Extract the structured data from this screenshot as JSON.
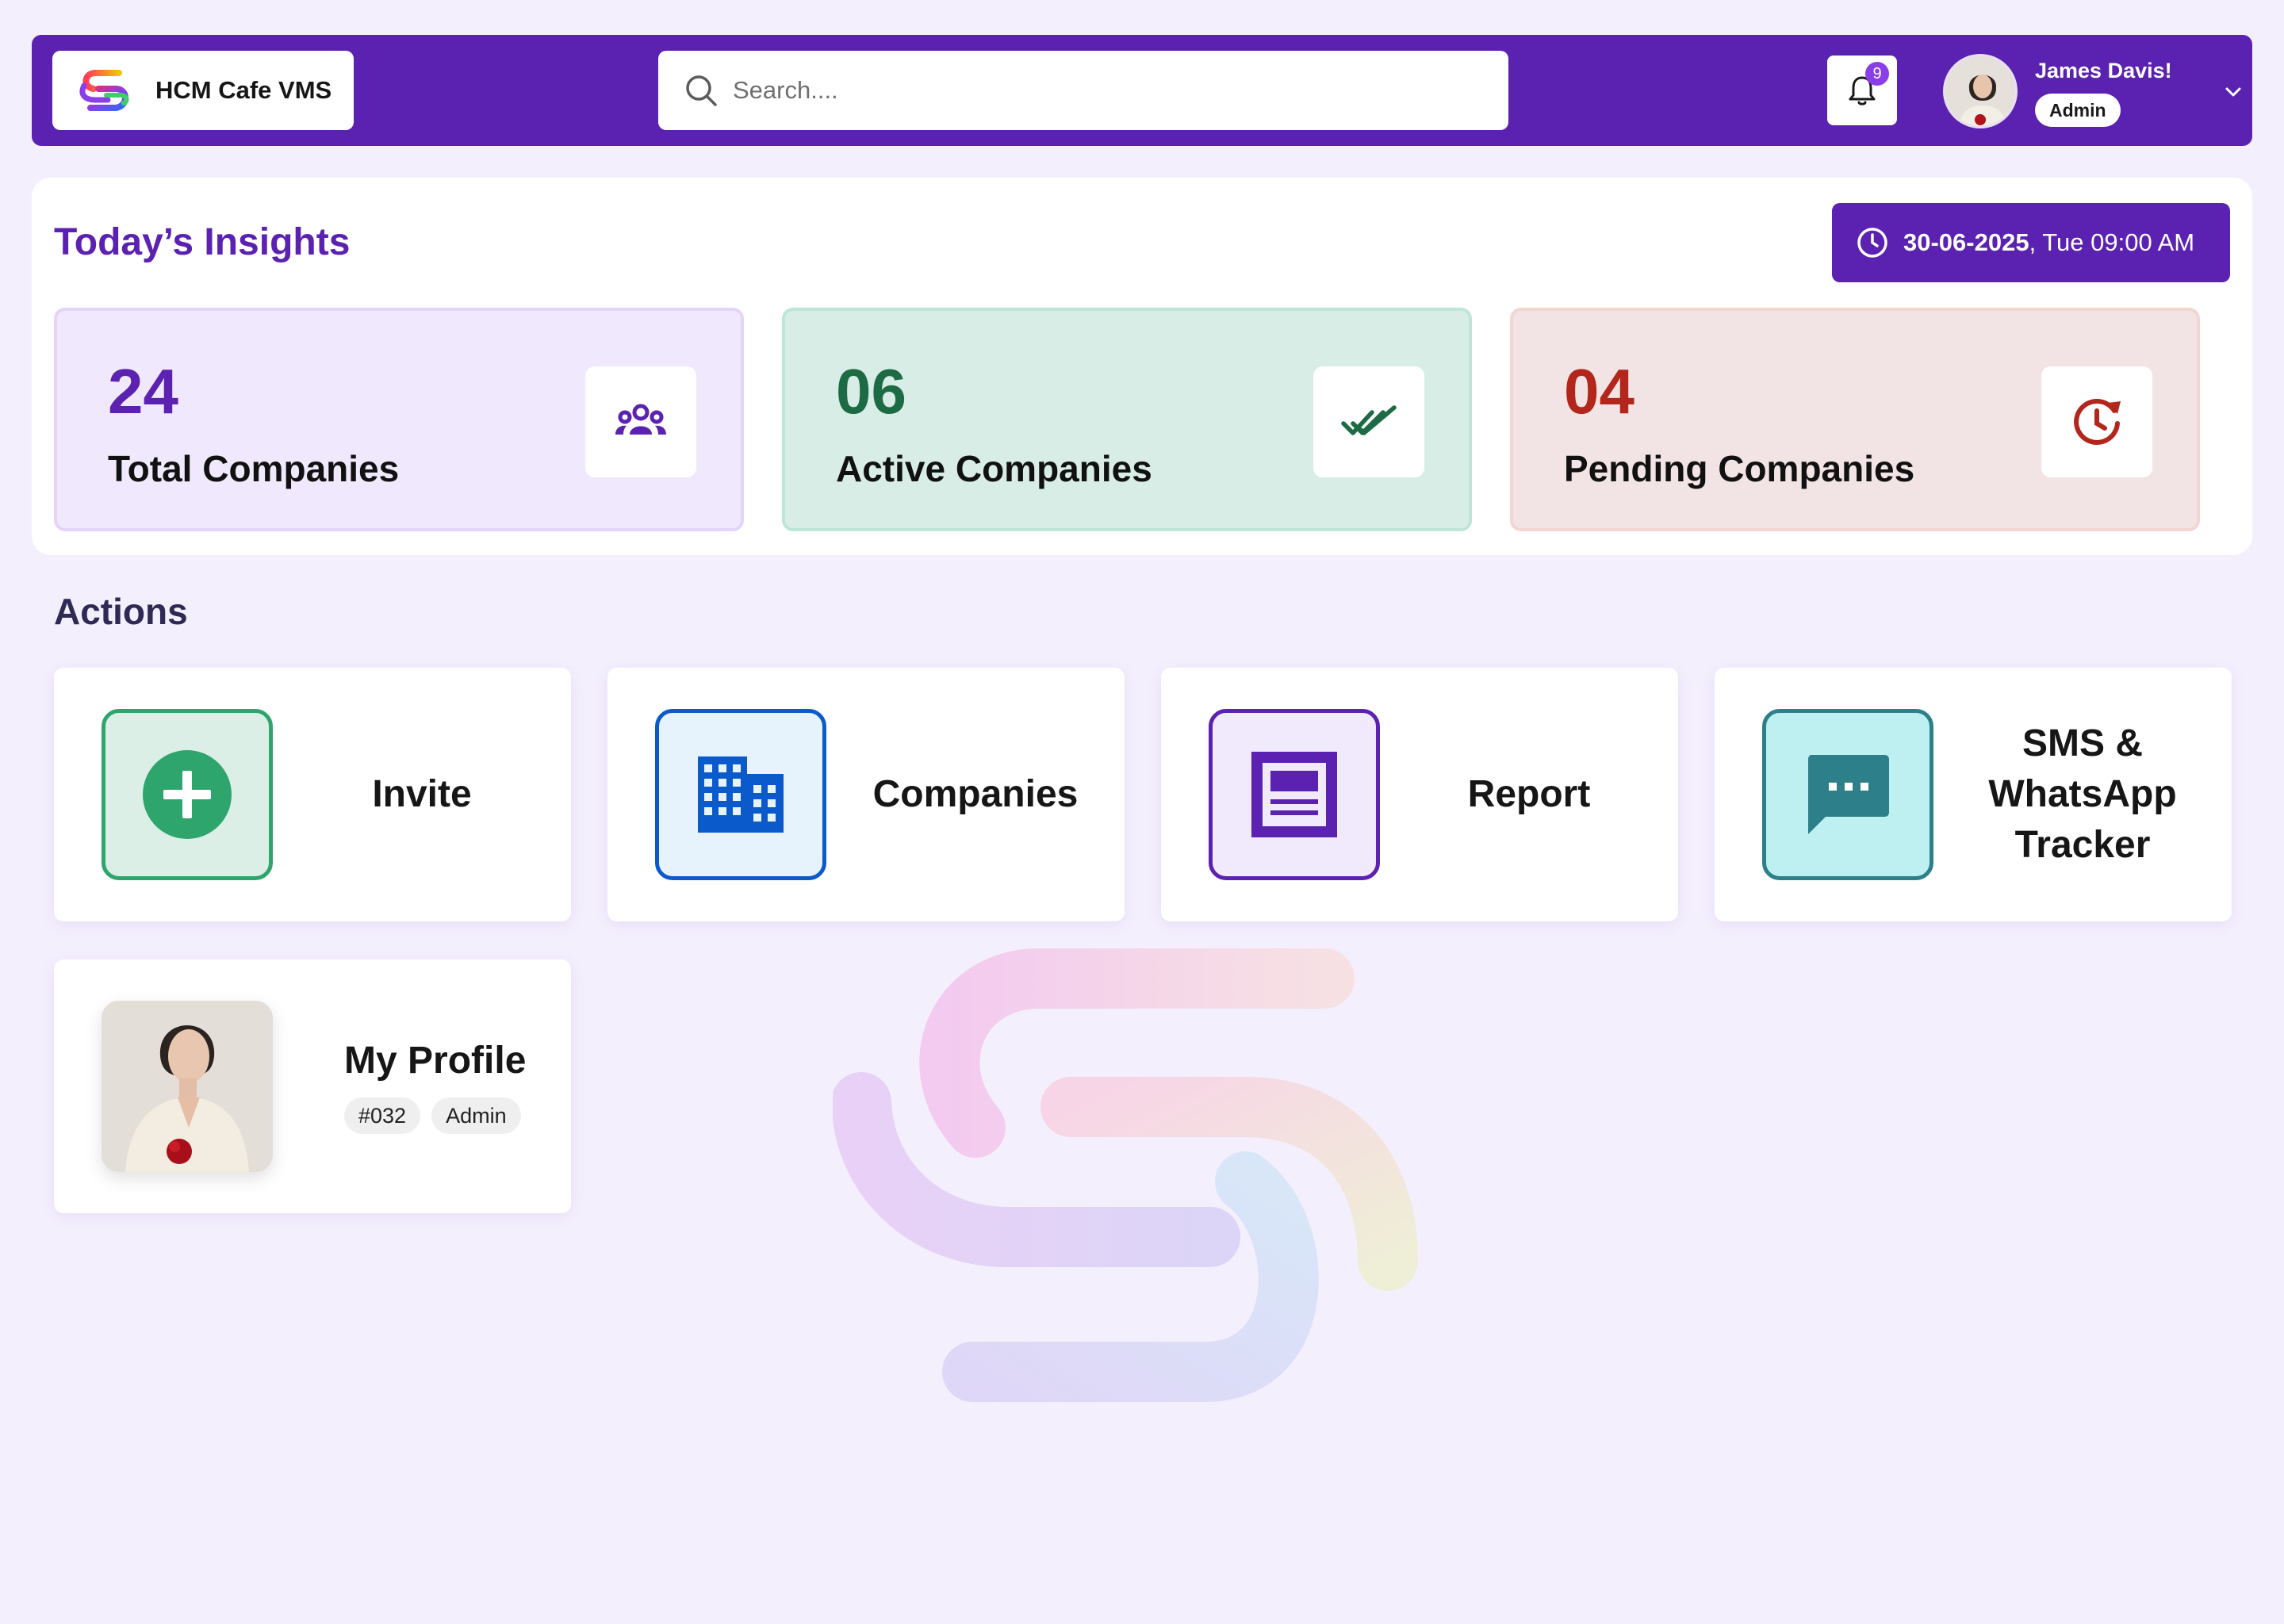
{
  "header": {
    "brand_name": "HCM Cafe VMS",
    "search_placeholder": "Search....",
    "notification_count": "9",
    "user_name": "James Davis!",
    "user_role": "Admin",
    "brand_color": "#5b21b0"
  },
  "insights": {
    "title": "Today’s Insights",
    "date": "30-06-2025",
    "time": ", Tue 09:00 AM",
    "stats": [
      {
        "value": "24",
        "label": "Total Companies",
        "icon": "users-icon",
        "color": "#5b21b0"
      },
      {
        "value": "06",
        "label": "Active Companies",
        "icon": "double-check-icon",
        "color": "#1d6b45"
      },
      {
        "value": "04",
        "label": "Pending Companies",
        "icon": "clock-refresh-icon",
        "color": "#b2261b"
      }
    ]
  },
  "actions": {
    "title": "Actions",
    "items": [
      {
        "label": "Invite",
        "icon": "plus-circle-icon",
        "color": "#2ea56d"
      },
      {
        "label": "Companies",
        "icon": "building-icon",
        "color": "#0b5acb"
      },
      {
        "label": "Report",
        "icon": "report-icon",
        "color": "#5b21b0"
      },
      {
        "label": "SMS & WhatsApp Tracker",
        "icon": "chat-icon",
        "color": "#2d7f8a"
      }
    ],
    "profile": {
      "label": "My Profile",
      "id": "#032",
      "role": "Admin"
    }
  }
}
